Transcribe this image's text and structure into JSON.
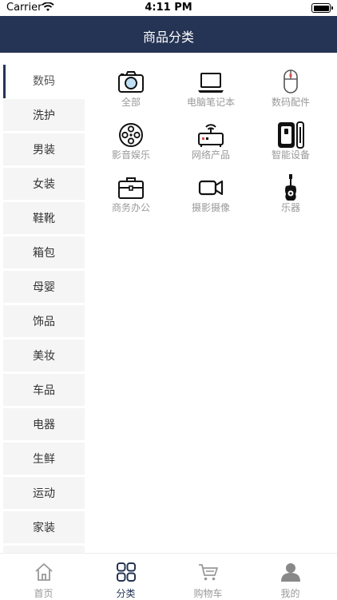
{
  "status": {
    "carrier": "Carrier",
    "time": "4:11 PM"
  },
  "header": {
    "title": "商品分类"
  },
  "sidebar": {
    "active_index": 0,
    "items": [
      {
        "label": "数码"
      },
      {
        "label": "洗护"
      },
      {
        "label": "男装"
      },
      {
        "label": "女装"
      },
      {
        "label": "鞋靴"
      },
      {
        "label": "箱包"
      },
      {
        "label": "母婴"
      },
      {
        "label": "饰品"
      },
      {
        "label": "美妆"
      },
      {
        "label": "车品"
      },
      {
        "label": "电器"
      },
      {
        "label": "生鲜"
      },
      {
        "label": "运动"
      },
      {
        "label": "家装"
      },
      {
        "label": ""
      }
    ]
  },
  "categories": [
    {
      "label": "全部",
      "icon": "camera-icon"
    },
    {
      "label": "电脑笔记本",
      "icon": "laptop-icon"
    },
    {
      "label": "数码配件",
      "icon": "mouse-icon"
    },
    {
      "label": "影音娱乐",
      "icon": "film-reel-icon"
    },
    {
      "label": "网络产品",
      "icon": "router-icon"
    },
    {
      "label": "智能设备",
      "icon": "smart-device-icon"
    },
    {
      "label": "商务办公",
      "icon": "briefcase-icon"
    },
    {
      "label": "摄影摄像",
      "icon": "video-camera-icon"
    },
    {
      "label": "乐器",
      "icon": "guitar-icon"
    }
  ],
  "tabbar": {
    "active_index": 1,
    "tabs": [
      {
        "label": "首页",
        "icon": "home-icon"
      },
      {
        "label": "分类",
        "icon": "category-icon"
      },
      {
        "label": "购物车",
        "icon": "cart-icon"
      },
      {
        "label": "我的",
        "icon": "user-icon"
      }
    ]
  },
  "colors": {
    "primary": "#253454",
    "accent_blue": "#3a7bd5",
    "text_muted": "#999999",
    "sidebar_bg": "#f5f5f5"
  }
}
